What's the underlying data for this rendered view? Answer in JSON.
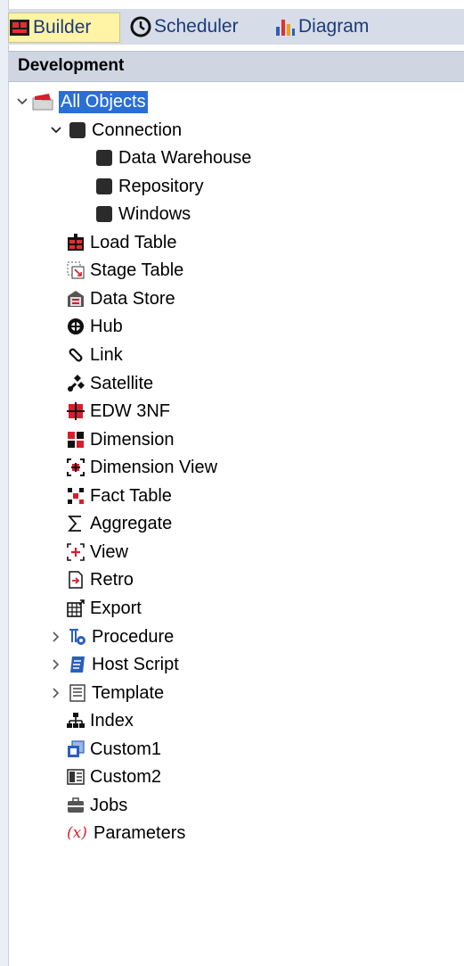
{
  "tabs": [
    {
      "label": "Builder",
      "icon": "builder-icon",
      "active": true
    },
    {
      "label": "Scheduler",
      "icon": "clock-icon",
      "active": false
    },
    {
      "label": "Diagram",
      "icon": "bar-chart-icon",
      "active": false
    }
  ],
  "header": {
    "title": "Development"
  },
  "tree": {
    "root": {
      "label": "All Objects",
      "selected": true
    },
    "items": [
      {
        "label": "Connection",
        "icon": "database-icon",
        "expander": "expanded",
        "level": 1
      },
      {
        "label": "Data Warehouse",
        "icon": "database-icon",
        "expander": "none",
        "level": 2
      },
      {
        "label": "Repository",
        "icon": "database-icon",
        "expander": "none",
        "level": 2
      },
      {
        "label": "Windows",
        "icon": "database-icon",
        "expander": "none",
        "level": 2
      },
      {
        "label": "Load Table",
        "icon": "load-table-icon",
        "expander": "none",
        "level": 1
      },
      {
        "label": "Stage Table",
        "icon": "stage-table-icon",
        "expander": "none",
        "level": 1
      },
      {
        "label": "Data Store",
        "icon": "data-store-icon",
        "expander": "none",
        "level": 1
      },
      {
        "label": "Hub",
        "icon": "hub-icon",
        "expander": "none",
        "level": 1
      },
      {
        "label": "Link",
        "icon": "link-icon",
        "expander": "none",
        "level": 1
      },
      {
        "label": "Satellite",
        "icon": "satellite-icon",
        "expander": "none",
        "level": 1
      },
      {
        "label": "EDW 3NF",
        "icon": "edw-icon",
        "expander": "none",
        "level": 1
      },
      {
        "label": "Dimension",
        "icon": "dimension-icon",
        "expander": "none",
        "level": 1
      },
      {
        "label": "Dimension View",
        "icon": "dimension-view-icon",
        "expander": "none",
        "level": 1
      },
      {
        "label": "Fact Table",
        "icon": "fact-table-icon",
        "expander": "none",
        "level": 1
      },
      {
        "label": "Aggregate",
        "icon": "sigma-icon",
        "expander": "none",
        "level": 1
      },
      {
        "label": "View",
        "icon": "view-icon",
        "expander": "none",
        "level": 1
      },
      {
        "label": "Retro",
        "icon": "retro-icon",
        "expander": "none",
        "level": 1
      },
      {
        "label": "Export",
        "icon": "export-icon",
        "expander": "none",
        "level": 1
      },
      {
        "label": "Procedure",
        "icon": "procedure-icon",
        "expander": "collapsed",
        "level": 1
      },
      {
        "label": "Host Script",
        "icon": "host-script-icon",
        "expander": "collapsed",
        "level": 1
      },
      {
        "label": "Template",
        "icon": "template-icon",
        "expander": "collapsed",
        "level": 1
      },
      {
        "label": "Index",
        "icon": "index-icon",
        "expander": "none",
        "level": 1
      },
      {
        "label": "Custom1",
        "icon": "custom1-icon",
        "expander": "none",
        "level": 1
      },
      {
        "label": "Custom2",
        "icon": "custom2-icon",
        "expander": "none",
        "level": 1
      },
      {
        "label": "Jobs",
        "icon": "jobs-icon",
        "expander": "none",
        "level": 1
      },
      {
        "label": "Parameters",
        "icon": "parameters-icon",
        "expander": "none",
        "level": 1
      }
    ]
  },
  "colors": {
    "selection": "#2a6fd6",
    "accent_red": "#d61f2b",
    "tab_active": "#fff3a6",
    "header_bg": "#cfd6e2"
  }
}
